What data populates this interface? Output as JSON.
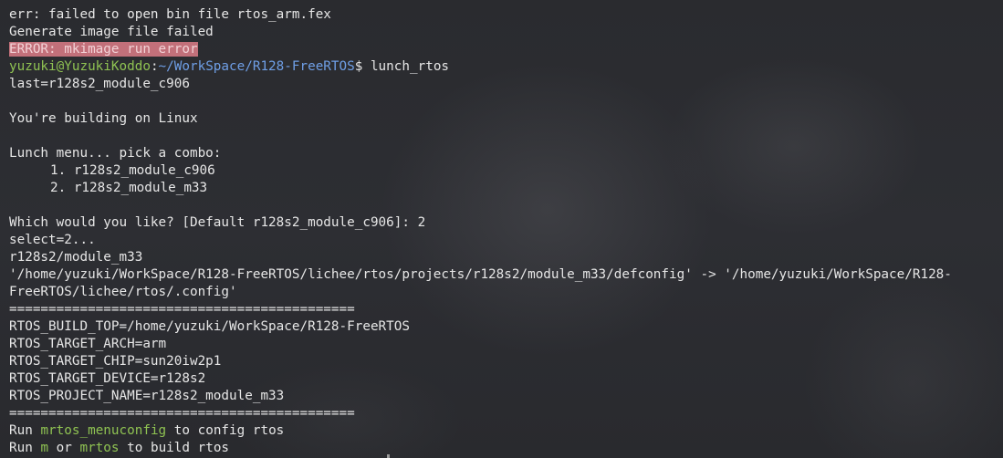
{
  "terminal": {
    "lines": [
      "err: failed to open bin file rtos_arm.fex",
      "Generate image file failed",
      "ERROR: mkimage run error",
      "",
      "last=r128s2_module_c906",
      "",
      "You're building on Linux",
      "",
      "Lunch menu... pick a combo:",
      "1. r128s2_module_c906",
      "2. r128s2_module_m33",
      "",
      "Which would you like? [Default r128s2_module_c906]: 2",
      "select=2...",
      "r128s2/module_m33",
      "'/home/yuzuki/WorkSpace/R128-FreeRTOS/lichee/rtos/projects/r128s2/module_m33/defconfig' -> '/home/yuzuki/WorkSpace/R128-",
      "FreeRTOS/lichee/rtos/.config'",
      "============================================",
      "RTOS_BUILD_TOP=/home/yuzuki/WorkSpace/R128-FreeRTOS",
      "RTOS_TARGET_ARCH=arm",
      "RTOS_TARGET_CHIP=sun20iw2p1",
      "RTOS_TARGET_DEVICE=r128s2",
      "RTOS_PROJECT_NAME=r128s2_module_m33",
      "============================================"
    ],
    "prompt": {
      "user_host": "yuzuki@YuzukiKoddo",
      "colon": ":",
      "path": "~/WorkSpace/R128-FreeRTOS",
      "dollar": "$ ",
      "command": "lunch_rtos"
    },
    "hint_config": {
      "prefix": "Run ",
      "command": "mrtos_menuconfig",
      "suffix": " to config rtos"
    },
    "hint_build": {
      "prefix": "Run ",
      "command_m": "m",
      "middle": " or ",
      "command_mrtos": "mrtos",
      "suffix": " to build rtos"
    }
  },
  "colors": {
    "background": "#2b2c30",
    "text": "#e6e6e6",
    "prompt_user": "#8fc252",
    "prompt_path": "#6f9fe6",
    "error_highlight": "#c2707a",
    "command_highlight": "#8fc252"
  }
}
